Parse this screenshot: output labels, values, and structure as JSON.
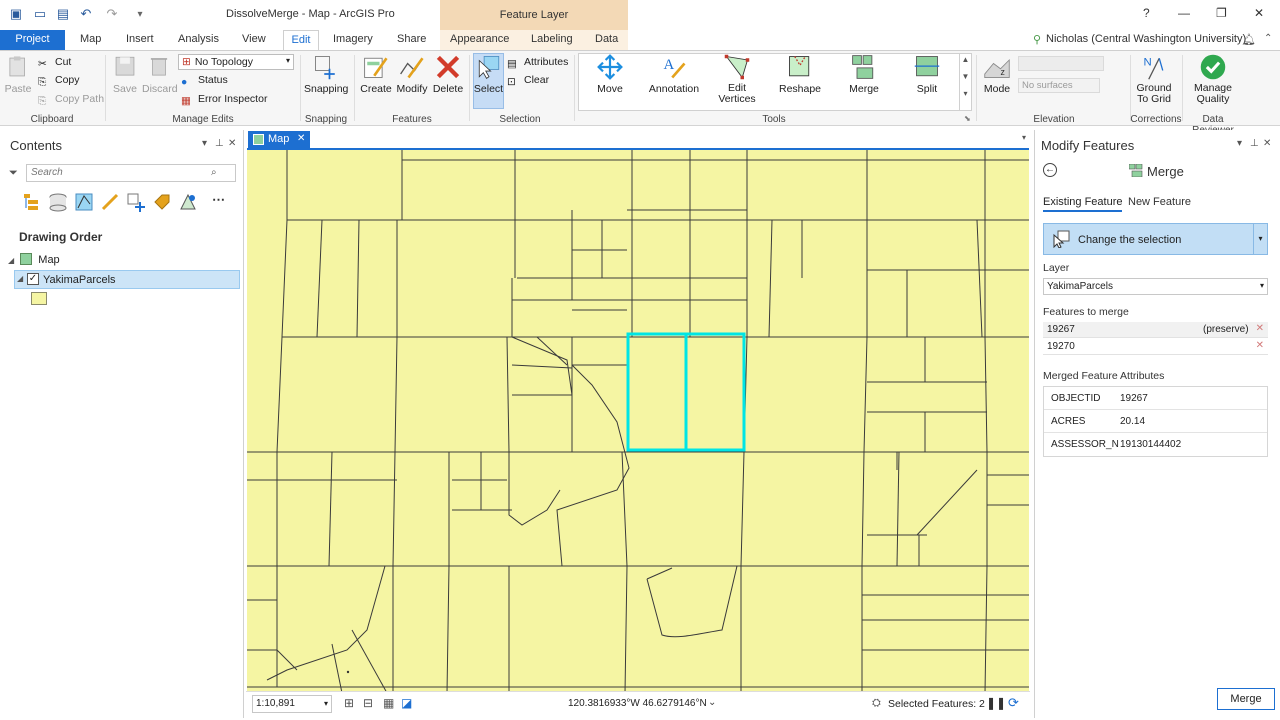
{
  "window": {
    "title": "DissolveMerge - Map - ArcGIS Pro",
    "context_tab_header": "Feature Layer",
    "help": "?",
    "minimize": "—",
    "restore": "❐",
    "close": "✕"
  },
  "tabs": {
    "project": "Project",
    "map": "Map",
    "insert": "Insert",
    "analysis": "Analysis",
    "view": "View",
    "edit": "Edit",
    "imagery": "Imagery",
    "share": "Share",
    "appearance": "Appearance",
    "labeling": "Labeling",
    "data": "Data"
  },
  "user": {
    "name": "Nicholas (Central Washington University)"
  },
  "ribbon": {
    "clipboard": {
      "paste": "Paste",
      "cut": "Cut",
      "copy": "Copy",
      "copy_path": "Copy Path",
      "label": "Clipboard"
    },
    "manage_edits": {
      "save": "Save",
      "discard": "Discard",
      "topology": "No Topology",
      "status": "Status",
      "error_inspector": "Error Inspector",
      "label": "Manage Edits"
    },
    "snapping": {
      "snapping": "Snapping",
      "label": "Snapping"
    },
    "features": {
      "create": "Create",
      "modify": "Modify",
      "delete": "Delete",
      "label": "Features"
    },
    "selection": {
      "select": "Select",
      "attributes": "Attributes",
      "clear": "Clear",
      "label": "Selection"
    },
    "tools": {
      "move": "Move",
      "annotation": "Annotation",
      "edit_vertices": "Edit Vertices",
      "reshape": "Reshape",
      "merge": "Merge",
      "split": "Split",
      "label": "Tools"
    },
    "elevation": {
      "mode": "Mode",
      "surface": "No surfaces",
      "label": "Elevation"
    },
    "corrections": {
      "ground_to_grid": "Ground To Grid",
      "label": "Corrections"
    },
    "data_reviewer": {
      "manage_quality": "Manage Quality",
      "label": "Data Reviewer"
    }
  },
  "contents": {
    "title": "Contents",
    "search_placeholder": "Search",
    "drawing_order": "Drawing Order",
    "map_item": "Map",
    "layer": "YakimaParcels"
  },
  "map": {
    "tab": "Map",
    "scale": "1:10,891",
    "coordinates": "120.3816933°W 46.6279146°N",
    "selected_features": "Selected Features: 2",
    "colors": {
      "fill": "#f5f5a3",
      "lines": "#3a3a3a",
      "selection": "#00e5e5"
    }
  },
  "modify": {
    "title": "Modify Features",
    "tool": "Merge",
    "tab_existing": "Existing Feature",
    "tab_new": "New Feature",
    "change_selection": "Change the selection",
    "layer_label": "Layer",
    "layer_value": "YakimaParcels",
    "features_label": "Features to merge",
    "features": [
      {
        "id": "19267",
        "note": "(preserve)"
      },
      {
        "id": "19270",
        "note": ""
      }
    ],
    "attributes_label": "Merged Feature Attributes",
    "attributes": [
      {
        "key": "OBJECTID",
        "value": "19267"
      },
      {
        "key": "ACRES",
        "value": "20.14"
      },
      {
        "key": "ASSESSOR_N",
        "value": "19130144402"
      }
    ],
    "merge_button": "Merge"
  }
}
